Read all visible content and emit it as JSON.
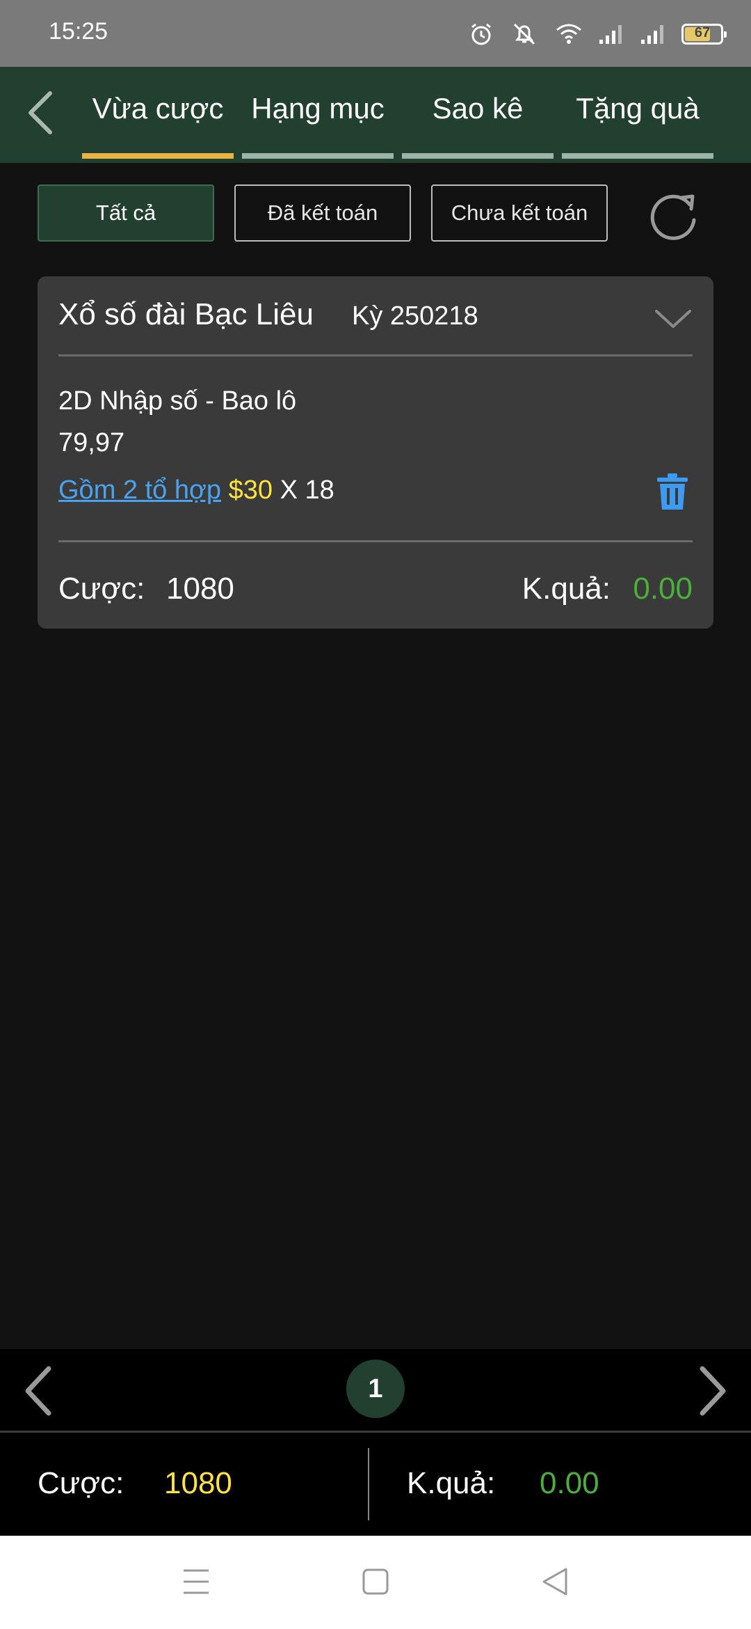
{
  "status_bar": {
    "time": "15:25",
    "battery_level": "67",
    "battery_fraction": 0.67,
    "icons": [
      "alarm-icon",
      "silent-icon",
      "wifi-icon",
      "signal-icon",
      "signal-icon",
      "battery-icon"
    ]
  },
  "header": {
    "back_icon": "chevron-left-icon",
    "tabs": [
      {
        "label": "Vừa cược",
        "active": true
      },
      {
        "label": "Hạng mục",
        "active": false
      },
      {
        "label": "Sao kê",
        "active": false
      },
      {
        "label": "Tặng quà",
        "active": false
      }
    ]
  },
  "filters": {
    "all": "Tất cả",
    "settled": "Đã kết toán",
    "unsettled": "Chưa kết toán",
    "refresh_icon": "refresh-icon"
  },
  "bet_card": {
    "title": "Xổ số đài Bạc Liêu",
    "period": "Kỳ 250218",
    "bet_type": "2D Nhập số - Bao lô",
    "numbers": "79,97",
    "combo_link": "Gồm 2 tổ hợp",
    "price": "$30",
    "multiplier": "X 18",
    "bet_label": "Cược:",
    "bet_value": "1080",
    "result_label": "K.quả:",
    "result_value": "0.00"
  },
  "pager": {
    "current_page": "1"
  },
  "totals": {
    "bet_label": "Cược:",
    "bet_value": "1080",
    "result_label": "K.quả:",
    "result_value": "0.00"
  },
  "colors": {
    "header_bg": "#22402f",
    "active_tab_underline": "#e8b645",
    "link": "#4aa3f0",
    "price": "#ffe23b",
    "result": "#4caf3b"
  }
}
